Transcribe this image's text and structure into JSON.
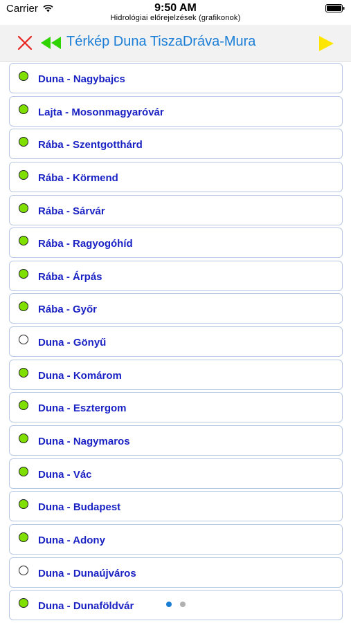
{
  "status_bar": {
    "carrier": "Carrier",
    "time": "9:50 AM",
    "subtitle": "Hidrológiai előrejelzések (grafikonok)"
  },
  "toolbar": {
    "close_icon": "close-x-icon",
    "rewind_icon": "rewind-icon",
    "title": "Térkép Duna TiszaDráva-Mura",
    "play_icon": "play-icon",
    "colors": {
      "close": "#e8201f",
      "rewind": "#2fd400",
      "title": "#1a7ed6",
      "play": "#ffe600"
    }
  },
  "stations": [
    {
      "label": "Duna - Nagybajcs",
      "status": "active"
    },
    {
      "label": "Lajta - Mosonmagyaróvár",
      "status": "active"
    },
    {
      "label": "Rába - Szentgotthárd",
      "status": "active"
    },
    {
      "label": "Rába - Körmend",
      "status": "active"
    },
    {
      "label": "Rába - Sárvár",
      "status": "active"
    },
    {
      "label": "Rába - Ragyogóhíd",
      "status": "active"
    },
    {
      "label": "Rába - Árpás",
      "status": "active"
    },
    {
      "label": "Rába - Győr",
      "status": "active"
    },
    {
      "label": "Duna - Gönyű",
      "status": "inactive"
    },
    {
      "label": "Duna - Komárom",
      "status": "active"
    },
    {
      "label": "Duna - Esztergom",
      "status": "active"
    },
    {
      "label": "Duna - Nagymaros",
      "status": "active"
    },
    {
      "label": "Duna - Vác",
      "status": "active"
    },
    {
      "label": "Duna - Budapest",
      "status": "active"
    },
    {
      "label": "Duna - Adony",
      "status": "active"
    },
    {
      "label": "Duna - Dunaújváros",
      "status": "inactive"
    },
    {
      "label": "Duna - Dunaföldvár",
      "status": "active"
    }
  ],
  "page_indicator": {
    "total": 2,
    "current": 1,
    "active_color": "#1a7ed6",
    "inactive_color": "#b0b0b0"
  }
}
